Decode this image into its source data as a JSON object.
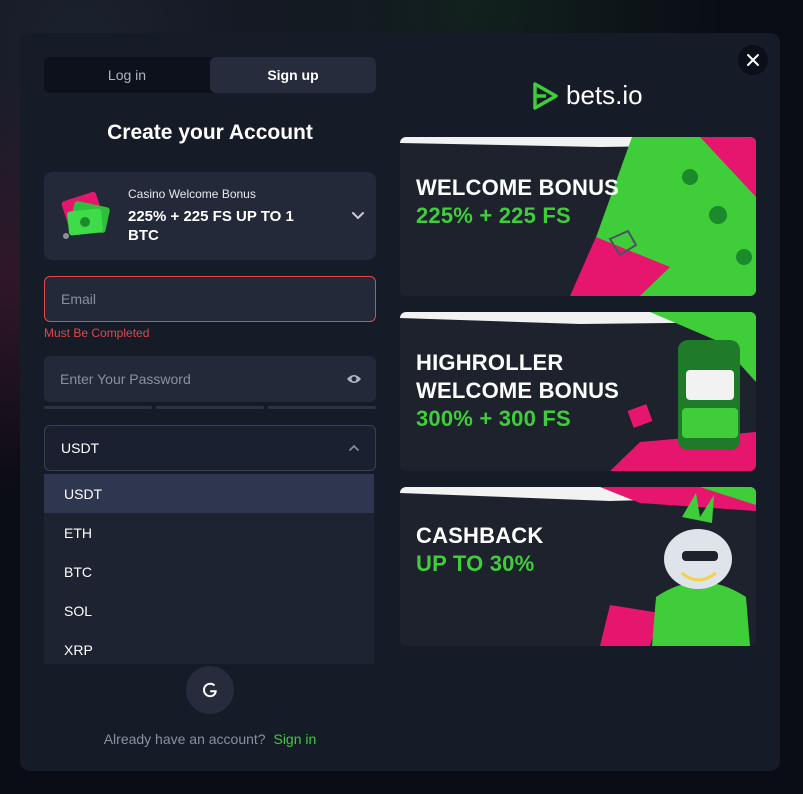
{
  "auth_tabs": {
    "login": "Log in",
    "signup": "Sign up"
  },
  "title": "Create your Account",
  "bonus": {
    "subtitle": "Casino Welcome Bonus",
    "offer": "225% + 225 FS UP TO 1 BTC"
  },
  "email": {
    "placeholder": "Email",
    "value": "",
    "error": "Must Be Completed"
  },
  "password": {
    "placeholder": "Enter Your Password",
    "value": ""
  },
  "currency": {
    "selected": "USDT",
    "options": [
      "USDT",
      "ETH",
      "BTC",
      "SOL",
      "XRP"
    ]
  },
  "footer": {
    "prompt": "Already have an account?",
    "signin": "Sign in"
  },
  "logo": {
    "text": "bets.io"
  },
  "banners": [
    {
      "line1": "WELCOME BONUS",
      "line2": "225% + 225 FS",
      "line3": ""
    },
    {
      "line1": "HIGHROLLER",
      "line2": "WELCOME BONUS",
      "line3": "300% + 300 FS"
    },
    {
      "line1": "CASHBACK",
      "line2": "UP TO 30%",
      "line3": ""
    }
  ],
  "colors": {
    "accent_green": "#3fcd3a",
    "error_red": "#e0484a",
    "pink": "#e6166f",
    "panel": "#161b28"
  },
  "icons": [
    "close-icon",
    "chevron-down-icon",
    "eye-icon",
    "chevron-up-icon",
    "google-icon",
    "bets-logo-icon"
  ]
}
